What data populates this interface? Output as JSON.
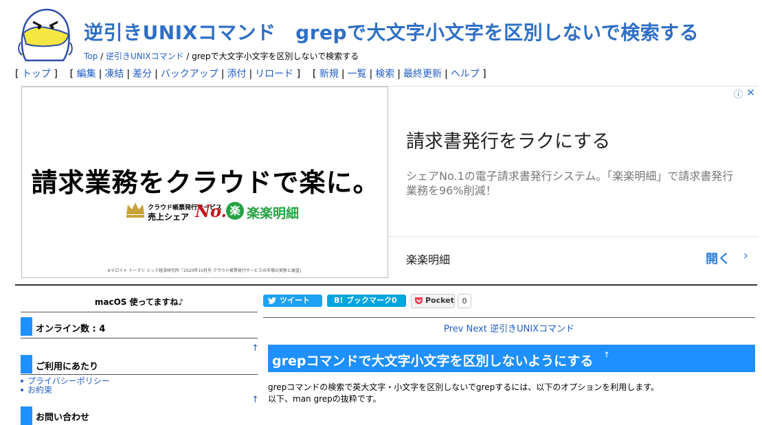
{
  "site": {
    "title": "逆引きUNIXコマンド　grepで大文字小文字を区別しないで検索する"
  },
  "breadcrumb": {
    "top": "Top",
    "parent": "逆引きUNIXコマンド",
    "current": "grepで大文字小文字を区別しないで検索する"
  },
  "menu": {
    "items": [
      "トップ",
      "編集",
      "凍結",
      "差分",
      "バックアップ",
      "添付",
      "リロード",
      "新規",
      "一覧",
      "検索",
      "最終更新",
      "ヘルプ"
    ]
  },
  "ad": {
    "headline": "請求業務をクラウドで楽に。",
    "service_label": "クラウド帳票発行サービス",
    "share_label": "売上シェア",
    "no1": "No.1",
    "brand_mark": "楽",
    "brand": "楽楽明細",
    "footnote": "※デロイト トーマツ ミック経済研究所「2020年10月号 クラウド帳票発行サービスの市場の実態と展望」",
    "title": "請求書発行をラクにする",
    "description": "シェアNo.1の電子請求書発行システム。「楽楽明細」で請求書発行業務を96%削減！",
    "sponsor": "楽楽明細",
    "cta": "開く",
    "info_icon": "ⓘ",
    "close_icon": "✕",
    "chevron_icon": "›"
  },
  "sidebar": {
    "notice": "macOS 使ってますね♪",
    "online": "オンライン数 : 4",
    "section_title": "ご利用にあたり",
    "links": [
      "プライバシーポリシー",
      "お約束"
    ],
    "up_arrow": "↑",
    "partial_next": "お問い合わせ"
  },
  "share": {
    "tweet": "ツイート",
    "hatena_b": "B!",
    "hatena": "ブックマーク",
    "hatena_count": "0",
    "pocket": "Pocket",
    "pocket_count": "0"
  },
  "nav": {
    "prev": "Prev",
    "next": "Next",
    "home": "逆引きUNIXコマンド"
  },
  "article": {
    "heading": "grepコマンドで大文字小文字を区別しないようにする",
    "heading_arrow": "↑",
    "line1": "grepコマンドの検索で英大文字・小文字を区別しないでgrepするには、以下のオプションを利用します。",
    "line2": "以下、man grepの抜粋です。"
  },
  "colors": {
    "link": "#215dc6",
    "title": "#2f6fc5",
    "accent": "#1e90ff",
    "twitter": "#1da1f2",
    "hatena": "#00a4de",
    "rakuraku": "#27a243"
  }
}
